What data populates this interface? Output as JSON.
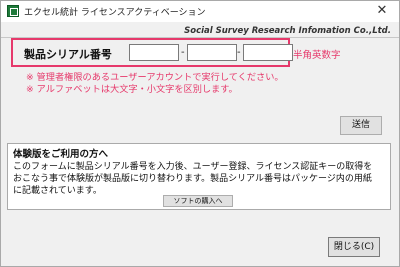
{
  "window": {
    "title": "エクセル統計 ライセンスアクティベーション",
    "close_glyph": "✕",
    "icon": "excel-stats-app-icon"
  },
  "company": "Social Survey Research Infomation Co.,Ltd.",
  "serial": {
    "label": "製品シリアル番号",
    "colon": ":",
    "inputs": [
      "",
      "",
      ""
    ],
    "separator": "-",
    "hint": "半角英数字",
    "highlight_color": "#e6396b"
  },
  "notes": [
    "※ 管理者権限のあるユーザーアカウントで実行してください。",
    "※ アルファベットは大文字・小文字を区別します。"
  ],
  "send_button": "送信",
  "trial": {
    "title": "体験版をご利用の方へ",
    "lines": [
      "このフォームに製品シリアル番号を入力後、ユーザー登録、ライセンス認証キーの取得を",
      "おこなう事で体験版が製品版に切り替わります。製品シリアル番号はパッケージ内の用紙",
      "に記載されています。"
    ],
    "buy_button": "ソフトの購入へ"
  },
  "close_button": "閉じる(C)"
}
